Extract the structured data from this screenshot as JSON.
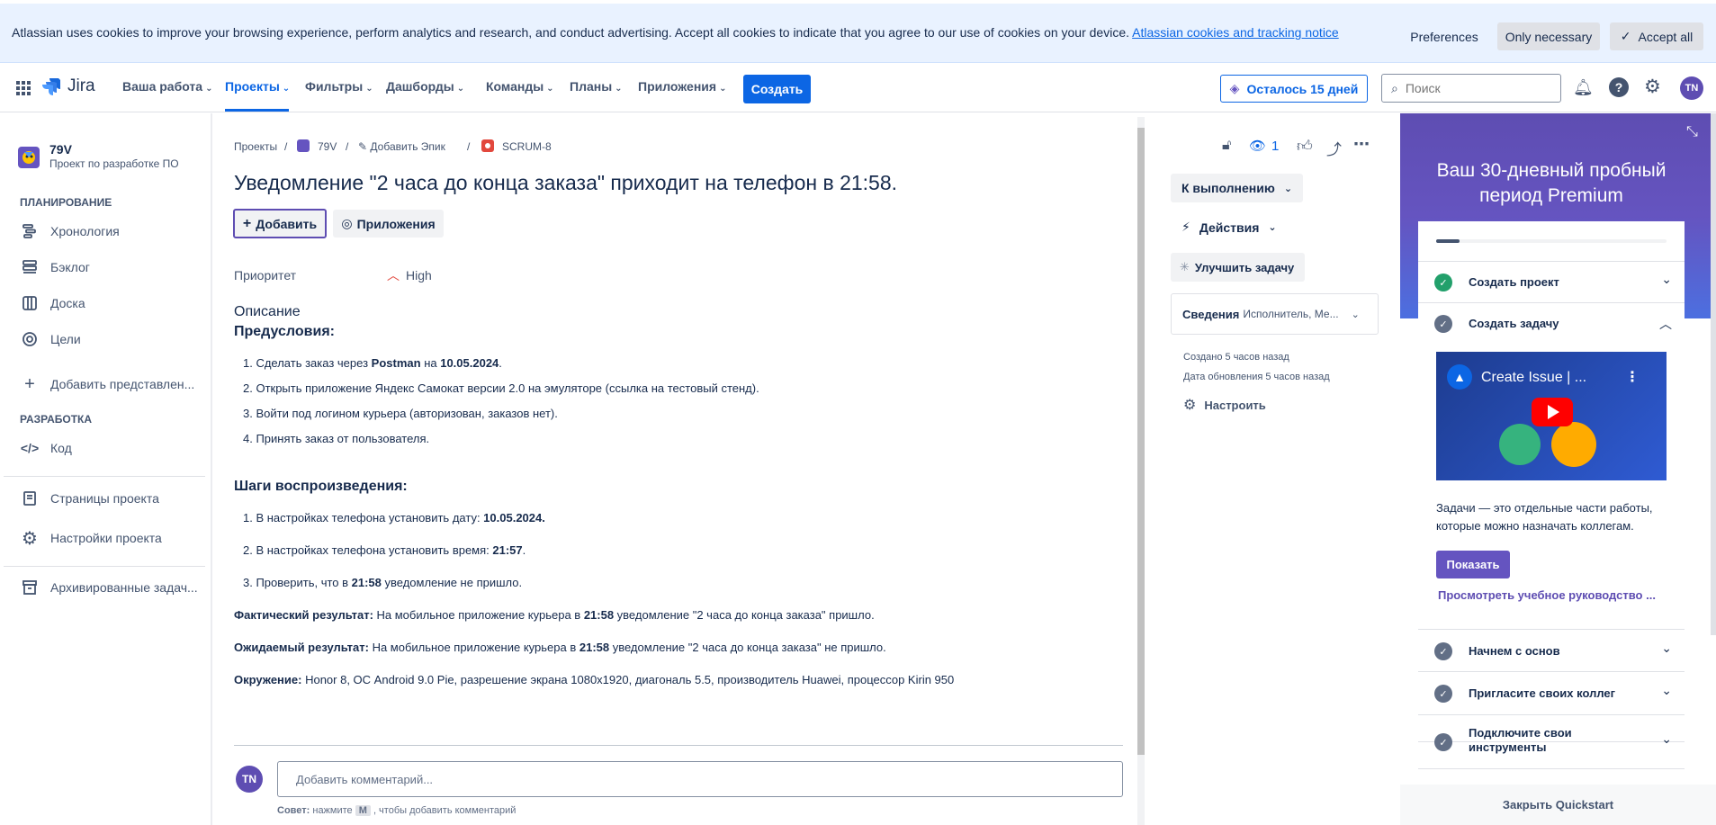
{
  "cookie_banner": {
    "message": "Atlassian uses cookies to improve your browsing experience, perform analytics and research, and conduct advertising. Accept all cookies to indicate that you agree to our use of cookies on your device.",
    "link": "Atlassian cookies and tracking notice",
    "preferences": "Preferences",
    "only_necessary": "Only necessary",
    "accept_all": "Accept all"
  },
  "topnav": {
    "logo": "Jira",
    "items": [
      "Ваша работа",
      "Проекты",
      "Фильтры",
      "Дашборды",
      "Команды",
      "Планы",
      "Приложения"
    ],
    "create": "Создать",
    "trial": "Осталось 15 дней",
    "search_placeholder": "Поиск",
    "avatar": "TN"
  },
  "sidebar": {
    "project_name": "79V",
    "project_type": "Проект по разработке ПО",
    "planning_heading": "ПЛАНИРОВАНИЕ",
    "planning": [
      "Хронология",
      "Бэклог",
      "Доска",
      "Цели",
      "Добавить представлен..."
    ],
    "dev_heading": "РАЗРАБОТКА",
    "code": "Код",
    "pages": "Страницы проекта",
    "settings": "Настройки проекта",
    "archived": "Архивированные задач..."
  },
  "issue": {
    "breadcrumbs": {
      "projects": "Проекты",
      "project": "79V",
      "add_epic": "Добавить Эпик",
      "key": "SCRUM-8"
    },
    "title": "Уведомление \"2 часа до конца заказа\" приходит на телефон в 21:58.",
    "add_button": "Добавить",
    "apps_button": "Приложения",
    "priority_label": "Приоритет",
    "priority_value": "High",
    "description_label": "Описание",
    "preconditions": "Предусловия:",
    "pre_1_a": "1. Сделать заказ через ",
    "pre_1_b": "Postman",
    "pre_1_c": " на ",
    "pre_1_d": "10.05.2024",
    "pre_1_e": ".",
    "pre_2": "2. Открыть приложение Яндекс Самокат версии 2.0 на эмуляторе (ссылка на тестовый стенд).",
    "pre_3": "3. Войти под логином курьера (авторизован, заказов нет).",
    "pre_4": "4. Принять заказ от пользователя.",
    "steps_heading": "Шаги воспроизведения:",
    "step_1_a": "1. В настройках телефона установить дату: ",
    "step_1_b": "10.05.2024.",
    "step_2_a": "2. В настройках телефона установить время: ",
    "step_2_b": "21:57",
    "step_2_c": ".",
    "step_3_a": "3. Проверить, что в ",
    "step_3_b": "21:58",
    "step_3_c": " уведомление не пришло.",
    "actual_label": "Фактический результат:",
    "actual_a": " На мобильное приложение курьера в ",
    "actual_b": "21:58",
    "actual_c": " уведомление \"2 часа до конца заказа\" пришло.",
    "expected_label": "Ожидаемый результат:",
    "expected_a": " На мобильное приложение курьера в ",
    "expected_b": "21:58",
    "expected_c": " уведомление \"2 часа до конца заказа\" не пришло.",
    "env_label": "Окружение:",
    "env_value": " Honor 8, ОС Android 9.0 Pie, разрешение экрана 1080x1920, диагональ 5.5, производитель Huawei, процессор Kirin 950",
    "comment_avatar": "TN",
    "comment_placeholder": "Добавить комментарий...",
    "tip_prefix": "Совет:",
    "tip_mid": " нажмите ",
    "tip_key": "M",
    "tip_suffix": " , чтобы добавить комментарий"
  },
  "details": {
    "watchers": "1",
    "status": "К выполнению",
    "actions": "Действия",
    "improve": "Улучшить задачу",
    "info_label": "Сведения",
    "info_value": "Исполнитель, Ме...",
    "created": "Создано 5 часов назад",
    "updated": "Дата обновления 5 часов назад",
    "configure": "Настроить"
  },
  "quickstart": {
    "title": "Ваш 30-дневный пробный период Premium",
    "progress": 0.1,
    "items": [
      "Создать проект",
      "Создать задачу",
      "Начнем с основ",
      "Пригласите своих коллег",
      "Подключите свои инструменты"
    ],
    "video_title": "Create Issue | ...",
    "description": "Задачи — это отдельные части работы, которые можно назначать коллегам.",
    "show_button": "Показать",
    "guide_link": "Просмотреть учебное руководство ...",
    "close": "Закрыть Quickstart"
  },
  "colors": {
    "accent": "#0c66e4",
    "premium": "#6554c0",
    "success": "#22a06b"
  }
}
